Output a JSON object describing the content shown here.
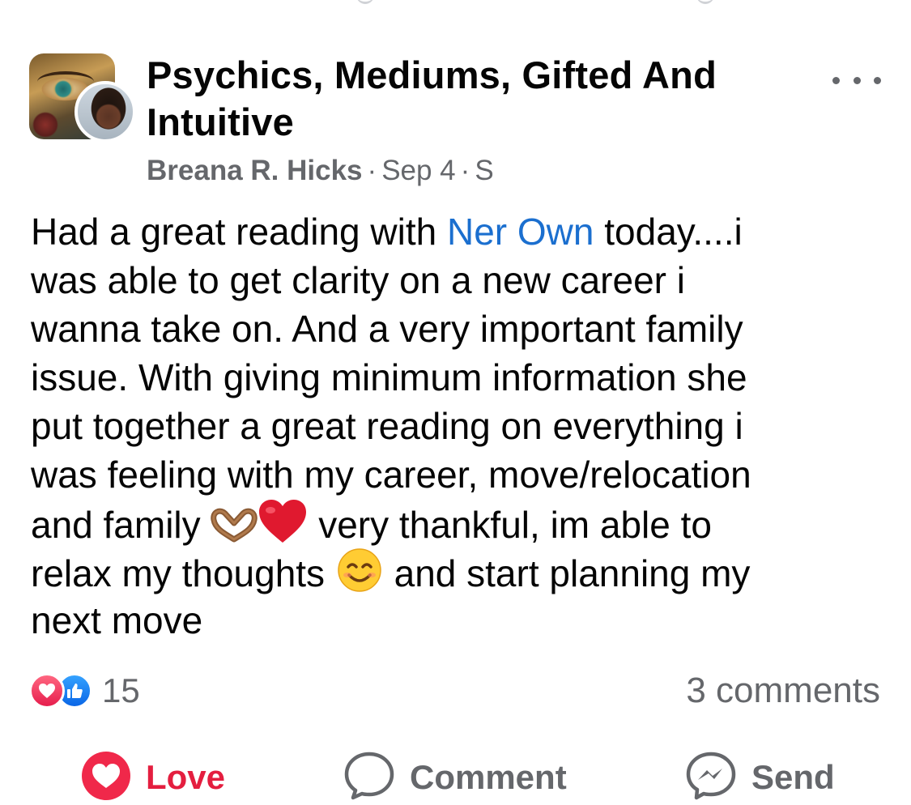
{
  "post": {
    "group_name": "Psychics, Mediums, Gifted And Intuitive",
    "author": "Breana R. Hicks",
    "date": "Sep 4",
    "audience": "S",
    "text_lines": [
      [
        "Had a great reading with ",
        "Ner Own",
        " today....i"
      ],
      "was able to get clarity on a new career i",
      "wanna take on. And a very important family",
      "issue. With giving minimum information she",
      "put together a great reading on everything i",
      "was feeling with my career, move/relocation",
      [
        "and family ",
        "",
        " very thankful, im able to"
      ],
      [
        "relax my thoughts ",
        "",
        " and start planning my"
      ],
      "next move"
    ],
    "reaction_count": "15",
    "comments_label": "3 comments"
  },
  "actions": {
    "love": "Love",
    "comment": "Comment",
    "send": "Send"
  },
  "icons": {
    "more": "more-options-icon",
    "heart_hands": "heart-hands-emoji",
    "red_heart": "red-heart-emoji",
    "smile": "smiling-face-emoji",
    "love_reaction": "love-reaction-icon",
    "like_reaction": "like-reaction-icon",
    "comment": "comment-icon",
    "messenger": "messenger-icon"
  },
  "colors": {
    "mention": "#1b6fcf",
    "love_active": "#e41e3f",
    "secondary_text": "#65676b"
  }
}
